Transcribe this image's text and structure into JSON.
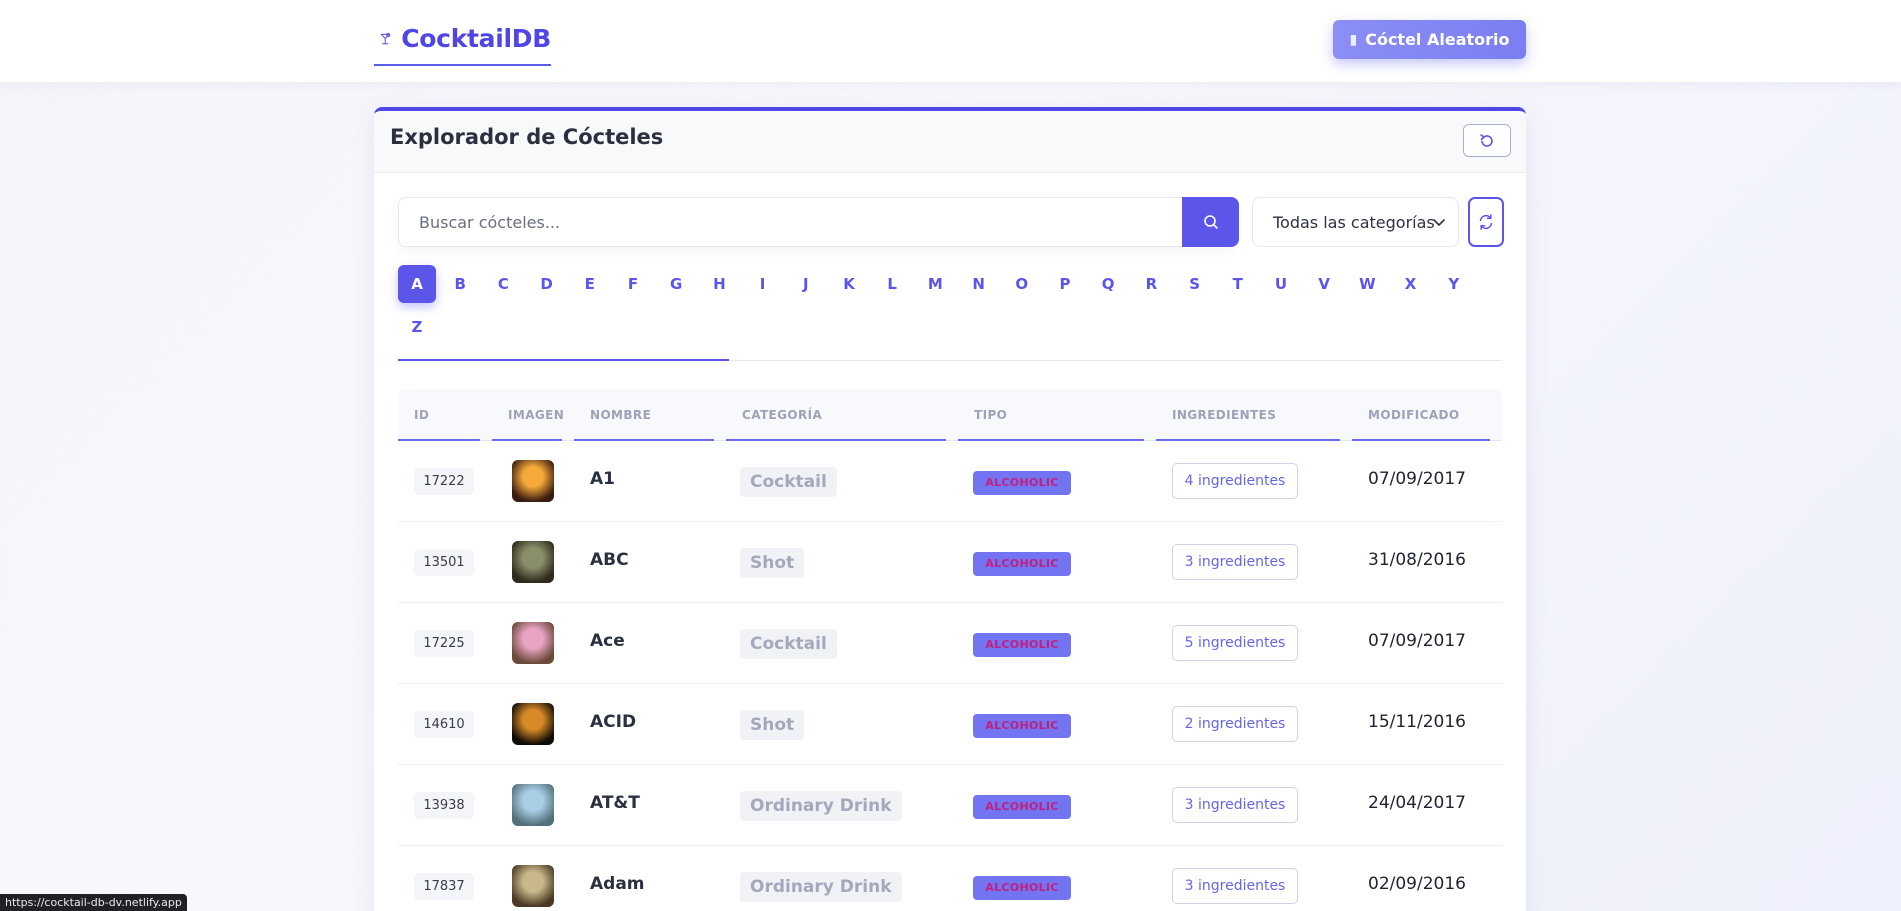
{
  "navbar": {
    "brand": "CocktailDB",
    "random_button": "Cóctel Aleatorio"
  },
  "card": {
    "title": "Explorador de Cócteles"
  },
  "search": {
    "placeholder": "Buscar cócteles..."
  },
  "category_select": {
    "selected": "Todas las categorías"
  },
  "letters": [
    "A",
    "B",
    "C",
    "D",
    "E",
    "F",
    "G",
    "H",
    "I",
    "J",
    "K",
    "L",
    "M",
    "N",
    "O",
    "P",
    "Q",
    "R",
    "S",
    "T",
    "U",
    "V",
    "W",
    "X",
    "Y",
    "Z"
  ],
  "active_letter": "A",
  "table": {
    "headers": [
      "ID",
      "IMAGEN",
      "NOMBRE",
      "CATEGORÍA",
      "TIPO",
      "INGREDIENTES",
      "MODIFICADO"
    ],
    "rows": [
      {
        "id": "17222",
        "name": "A1",
        "category": "Cocktail",
        "type": "ALCOHOLIC",
        "ingredients": "4 ingredientes",
        "modified": "07/09/2017",
        "thumb_colors": [
          "#f6a93b",
          "#3b1d10"
        ]
      },
      {
        "id": "13501",
        "name": "ABC",
        "category": "Shot",
        "type": "ALCOHOLIC",
        "ingredients": "3 ingredientes",
        "modified": "31/08/2016",
        "thumb_colors": [
          "#8a8f6a",
          "#2e2a1c"
        ]
      },
      {
        "id": "17225",
        "name": "Ace",
        "category": "Cocktail",
        "type": "ALCOHOLIC",
        "ingredients": "5 ingredientes",
        "modified": "07/09/2017",
        "thumb_colors": [
          "#e9a4c4",
          "#6b4a3a"
        ]
      },
      {
        "id": "14610",
        "name": "ACID",
        "category": "Shot",
        "type": "ALCOHOLIC",
        "ingredients": "2 ingredientes",
        "modified": "15/11/2016",
        "thumb_colors": [
          "#d88a26",
          "#120c08"
        ]
      },
      {
        "id": "13938",
        "name": "AT&T",
        "category": "Ordinary Drink",
        "type": "ALCOHOLIC",
        "ingredients": "3 ingredientes",
        "modified": "24/04/2017",
        "thumb_colors": [
          "#a9cfe6",
          "#54707c"
        ]
      },
      {
        "id": "17837",
        "name": "Adam",
        "category": "Ordinary Drink",
        "type": "ALCOHOLIC",
        "ingredients": "3 ingredientes",
        "modified": "02/09/2016",
        "thumb_colors": [
          "#c9b98a",
          "#4a3a25"
        ]
      }
    ]
  },
  "status_bar": {
    "url": "https://cocktail-db-dv.netlify.app"
  },
  "colors": {
    "accent": "#5b55ea",
    "type_badge_bg": "#7274f2",
    "type_badge_text": "#c0217f"
  }
}
